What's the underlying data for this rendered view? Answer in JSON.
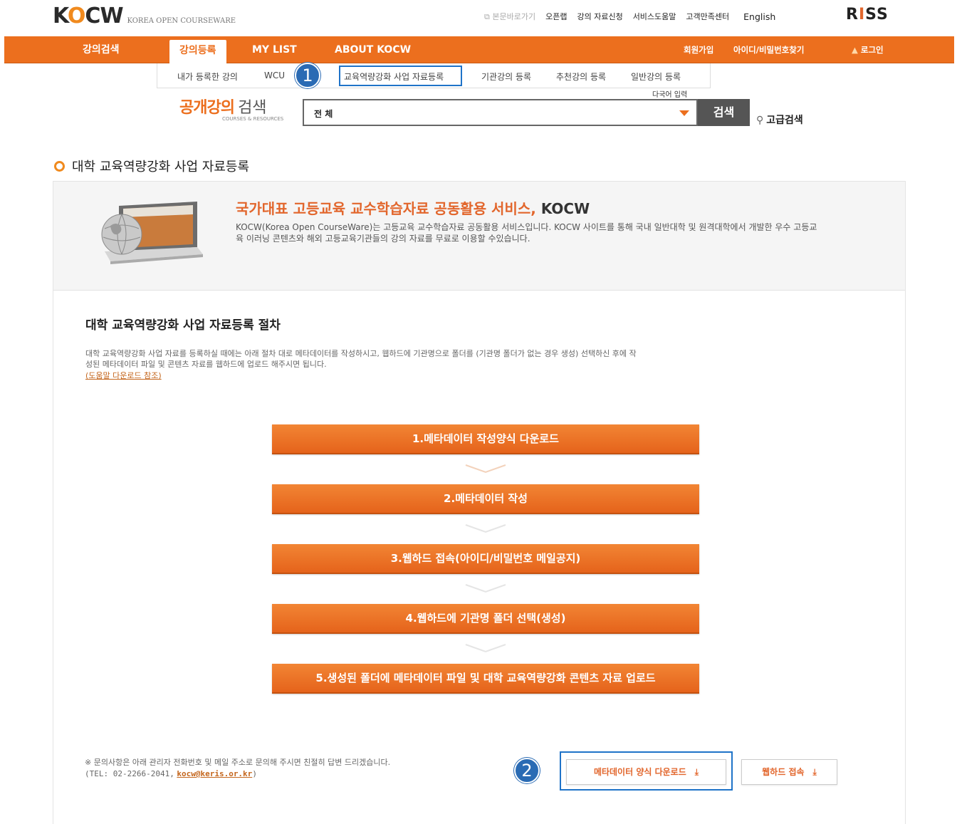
{
  "header": {
    "logo_text": "KOCW",
    "logo_sub": "KOREA OPEN COURSEWARE",
    "links": [
      "본문바로가기",
      "오픈랩",
      "강의 자료신청",
      "서비스도움말",
      "고객만족센터",
      "English"
    ],
    "riss": "RISS"
  },
  "nav": {
    "items": [
      "강의검색",
      "강의등록",
      "MY LIST",
      "ABOUT KOCW"
    ],
    "right": [
      "회원가입",
      "아이디/비밀번호찾기",
      "로그인"
    ]
  },
  "submenu": {
    "items": [
      "내가 등록한 강의",
      "WCU",
      "교육역량강화 사업 자료등록",
      "기관강의 등록",
      "추천강의 등록",
      "일반강의 등록"
    ],
    "multi_lang": "다국어 입력"
  },
  "badges": [
    "1",
    "2"
  ],
  "search": {
    "title_1": "공개강의",
    "title_2": "검색",
    "subtitle": "COURSES & RESOURCES",
    "select_value": "전 체",
    "button": "검색",
    "advanced": "고급검색"
  },
  "page": {
    "title": "대학 교육역량강화 사업 자료등록",
    "intro_heading": "국가대표 고등교육 교수학습자료 공동활용 서비스,",
    "intro_heading_kocw": "KOCW",
    "intro_text": "KOCW(Korea Open CourseWare)는 고등교육 교수학습자료 공동활용 서비스입니다. KOCW 사이트를 통해 국내 일반대학 및 원격대학에서 개발한 우수 고등교육 이러닝 콘텐츠와 해외 고등교육기관들의 강의 자료를 무료로 이용할 수있습니다.",
    "procedure_title": "대학 교육역량강화 사업 자료등록 절차",
    "procedure_desc": "대학 교육역량강화 사업 자료를 등록하실 때에는 아래 절차 대로 메타데이터를 작성하시고, 웹하드에 기관명으로 폴더를 (기관명 폴더가 없는 경우 생성) 선택하신 후에 작성된 메타데이터 파일 및 콘텐츠 자료를 웹하드에 업로드 해주시면 됩니다.",
    "procedure_ref": "(도움말 다운로드 참조)"
  },
  "steps": [
    "1.메타데이터 작성양식 다운로드",
    "2.메타데이터 작성",
    "3.웹하드 접속(아이디/비밀번호 메일공지)",
    "4.웹하드에 기관명 폴더 선택(생성)",
    "5.생성된 폴더에 메타데이터 파일 및 대학 교육역량강화 콘텐츠 자료 업로드"
  ],
  "footer": {
    "note": "※ 문의사항은 아래 관리자 전화번호 및 메일 주소로 문의해 주시면 친절히 답변 드리겠습니다.",
    "tel": "(TEL: 02-2266-2041,",
    "email": "kocw@keris.or.kr",
    "tel_close": ")",
    "btn_meta": "메타데이터 양식 다운로드",
    "btn_webhard": "웹하드 접속"
  },
  "colors": {
    "accent": "#ec6f1e",
    "highlight": "#1f73c8",
    "badge": "#2a6bb4"
  }
}
